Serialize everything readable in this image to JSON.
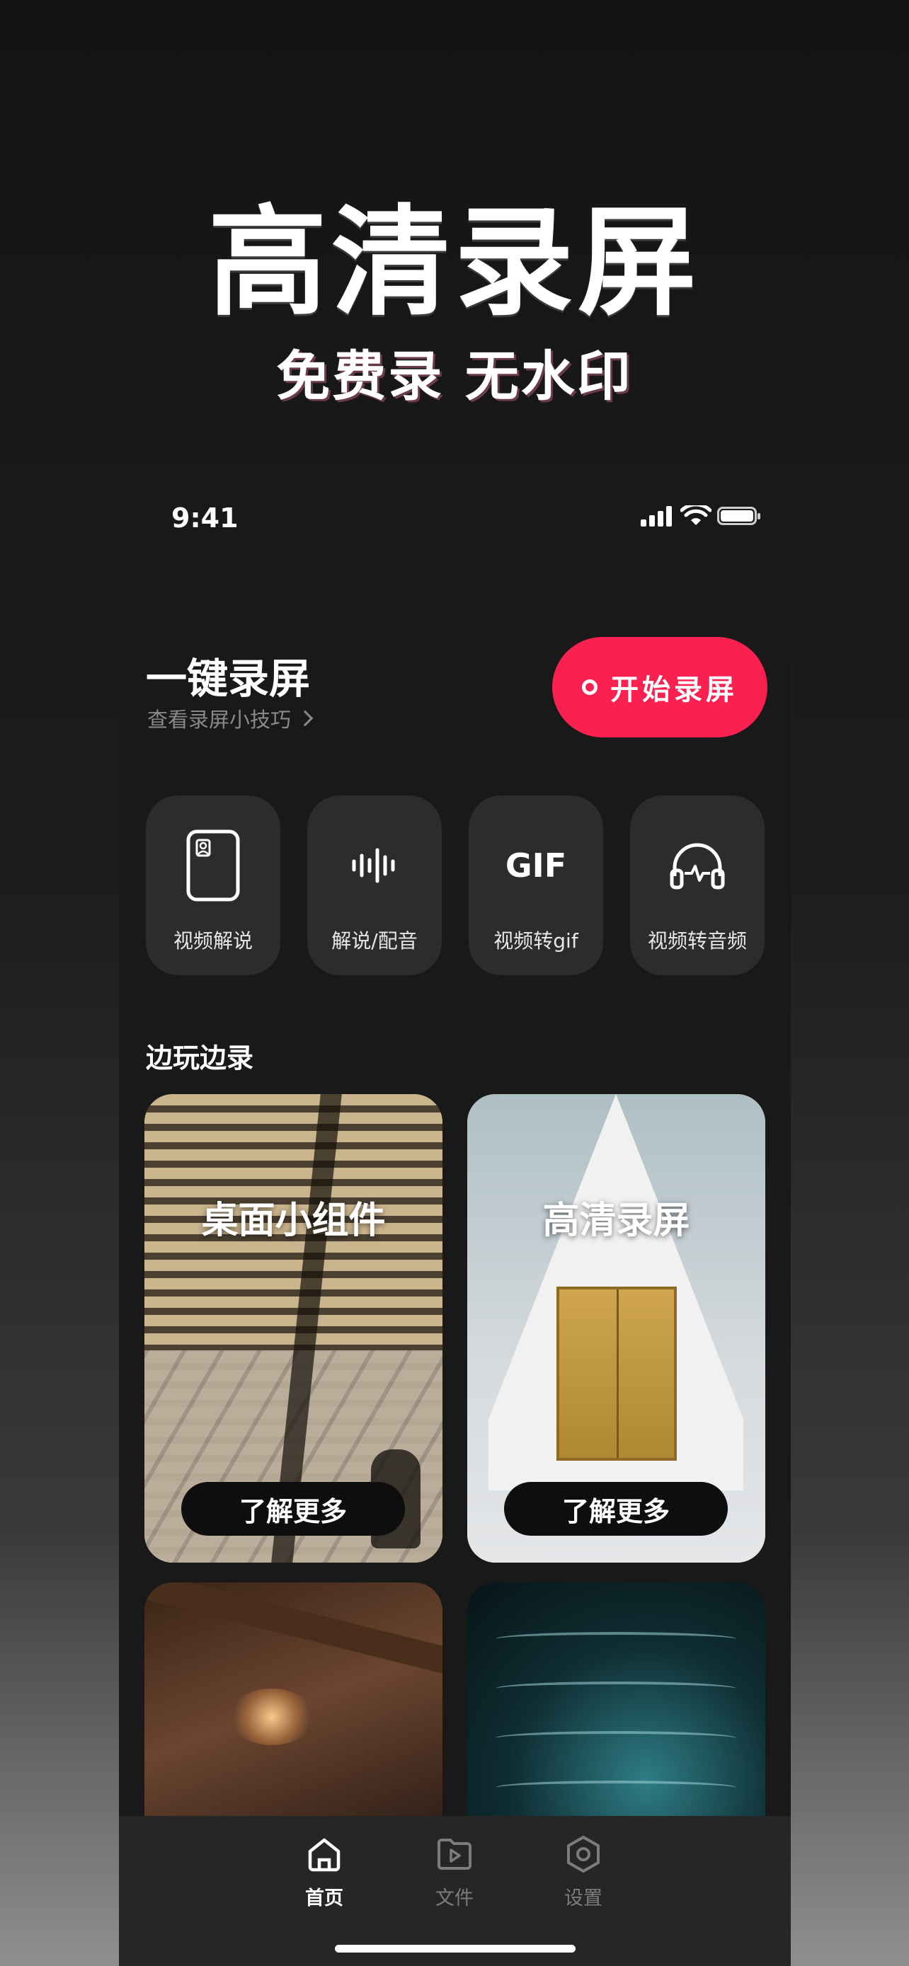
{
  "hero": {
    "title": "高清录屏",
    "subtitle": "免费录 无水印"
  },
  "status_bar": {
    "time": "9:41"
  },
  "record": {
    "title": "一键录屏",
    "tips_link": "查看录屏小技巧",
    "start_button": "开始录屏",
    "accent_color": "#fa2050"
  },
  "tools": [
    {
      "label": "视频解说",
      "icon": "phone-portrait-icon"
    },
    {
      "label": "解说/配音",
      "icon": "sound-wave-icon"
    },
    {
      "label": "视频转gif",
      "icon": "gif-icon",
      "icon_text": "GIF"
    },
    {
      "label": "视频转音频",
      "icon": "headphones-icon"
    }
  ],
  "section": {
    "title": "边玩边录"
  },
  "cards": [
    {
      "title": "桌面小组件",
      "button": "了解更多"
    },
    {
      "title": "高清录屏",
      "button": "了解更多"
    },
    {
      "title": "",
      "button": ""
    },
    {
      "title": "",
      "button": ""
    }
  ],
  "tabbar": {
    "items": [
      {
        "label": "首页",
        "icon": "home-icon",
        "active": true
      },
      {
        "label": "文件",
        "icon": "video-file-icon",
        "active": false
      },
      {
        "label": "设置",
        "icon": "settings-icon",
        "active": false
      }
    ]
  }
}
